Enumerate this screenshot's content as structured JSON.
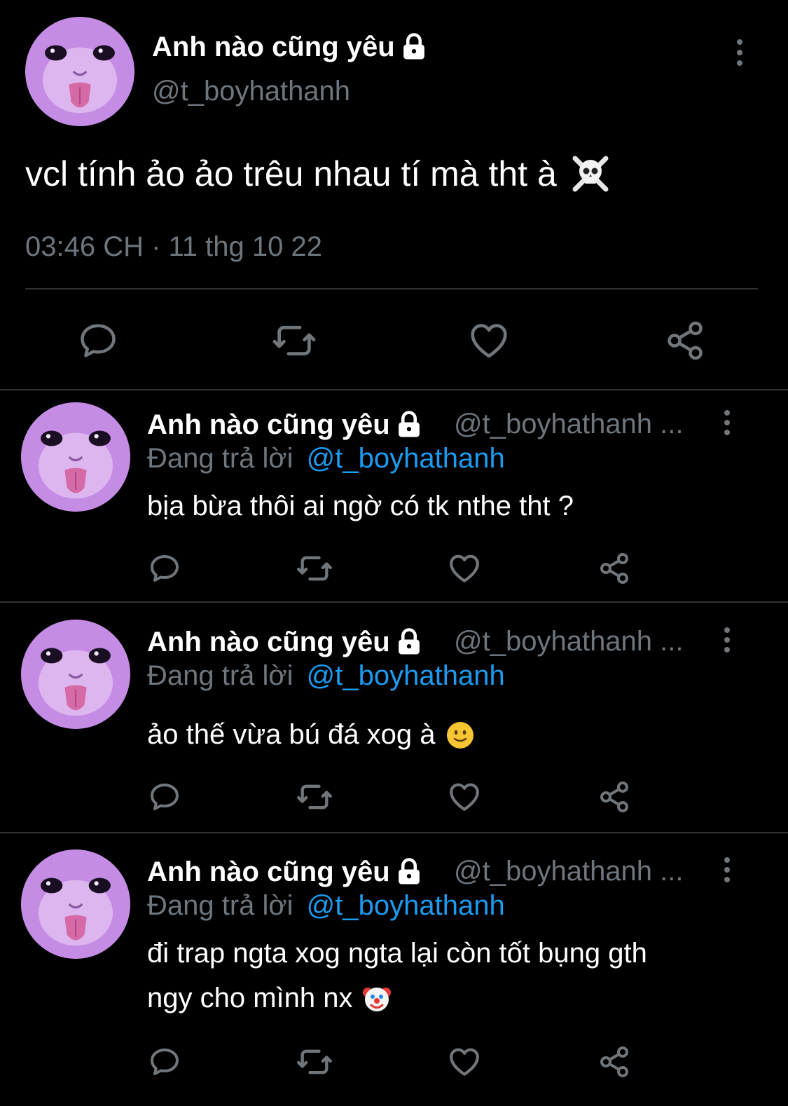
{
  "main_tweet": {
    "display_name": "Anh nào cũng yêu",
    "handle": "@t_boyhathanh",
    "text": "vcl tính ảo ảo trêu nhau tí mà tht à",
    "timestamp": "03:46 CH · 11 thg 10 22"
  },
  "replies": [
    {
      "display_name": "Anh nào cũng yêu",
      "handle": "@t_boyhathanh ...",
      "replying_label": "Đang trả lời",
      "replying_to": "@t_boyhathanh",
      "text": "bịa bừa thôi ai ngờ có tk nthe tht ?"
    },
    {
      "display_name": "Anh nào cũng yêu",
      "handle": "@t_boyhathanh ...",
      "replying_label": "Đang trả lời",
      "replying_to": "@t_boyhathanh",
      "text": "ảo thế vừa bú đá xog à"
    },
    {
      "display_name": "Anh nào cũng yêu",
      "handle": "@t_boyhathanh ...",
      "replying_label": "Đang trả lời",
      "replying_to": "@t_boyhathanh",
      "text_line1": "đi trap ngta xog ngta lại còn tốt bụng gth",
      "text_line2": "ngy cho mình nx"
    }
  ],
  "icons": {
    "reply": "reply-icon",
    "retweet": "retweet-icon",
    "like": "heart-icon",
    "share": "share-icon",
    "more": "more-vertical-icon",
    "lock": "lock-icon"
  },
  "colors": {
    "background": "#000000",
    "muted": "#6e767d",
    "link": "#1d9bf0",
    "avatar": "#c78fe6"
  }
}
